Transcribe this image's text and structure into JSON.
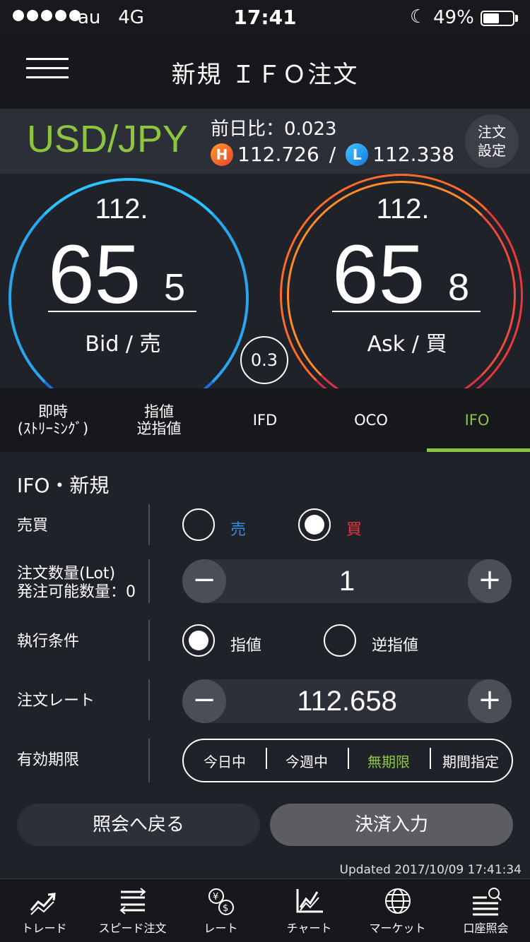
{
  "status_bar": {
    "carrier": "au",
    "network": "4G",
    "time": "17:41",
    "battery_percent": "49%"
  },
  "header": {
    "title": "新規 ＩＦＯ注文"
  },
  "pair": {
    "symbol": "USD/JPY",
    "change_label": "前日比：0.023",
    "high_badge": "H",
    "high_value": "112.726",
    "separator": "/",
    "low_badge": "L",
    "low_value": "112.338",
    "order_settings_line1": "注文",
    "order_settings_line2": "設定"
  },
  "quotes": {
    "bid": {
      "prefix": "112.",
      "main": "65",
      "last": "5",
      "label": "Bid / 売"
    },
    "ask": {
      "prefix": "112.",
      "main": "65",
      "last": "8",
      "label": "Ask / 買"
    },
    "spread": "0.3",
    "colors": {
      "bid": "#29a5f0",
      "ask": "#ff6a2c"
    }
  },
  "tabs": [
    {
      "line1": "即時",
      "line2": "(ｽﾄﾘｰﾐﾝｸﾞ)",
      "active": false
    },
    {
      "line1": "指値",
      "line2": "逆指値",
      "active": false
    },
    {
      "line1": "IFD",
      "line2": "",
      "active": false
    },
    {
      "line1": "OCO",
      "line2": "",
      "active": false
    },
    {
      "line1": "IFO",
      "line2": "",
      "active": true
    }
  ],
  "form": {
    "title": "IFO・新規",
    "side": {
      "label": "売買",
      "sell": "売",
      "buy": "買",
      "selected": "buy",
      "sell_color": "#2f8ee8",
      "buy_color": "#e8353f"
    },
    "quantity": {
      "label_line1": "注文数量(Lot)",
      "label_line2": "発注可能数量：0",
      "value": "1",
      "minus": "−",
      "plus": "+"
    },
    "condition": {
      "label": "執行条件",
      "limit": "指値",
      "stop": "逆指値",
      "selected": "limit"
    },
    "rate": {
      "label": "注文レート",
      "value": "112.658",
      "minus": "−",
      "plus": "+"
    },
    "expiry": {
      "label": "有効期限",
      "options": [
        "今日中",
        "今週中",
        "無期限",
        "期間指定"
      ],
      "selected": "無期限"
    },
    "back_button": "照会へ戻る",
    "settle_button": "決済入力",
    "updated": "Updated  2017/10/09 17:41:34",
    "accent_color": "#8cc63f"
  },
  "bottom_nav": [
    {
      "label": "トレード",
      "icon": "trade-chart-icon"
    },
    {
      "label": "スピード注文",
      "icon": "speed-order-icon"
    },
    {
      "label": "レート",
      "icon": "currency-rate-icon"
    },
    {
      "label": "チャート",
      "icon": "line-chart-icon"
    },
    {
      "label": "マーケット",
      "icon": "globe-icon"
    },
    {
      "label": "口座照会",
      "icon": "account-inquiry-icon"
    }
  ]
}
